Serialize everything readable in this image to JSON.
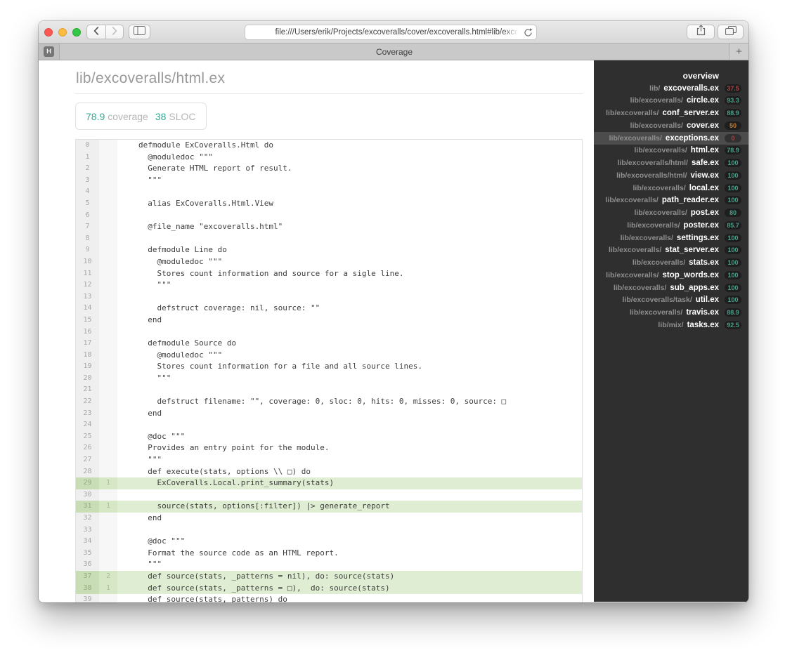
{
  "colors": {
    "accent": "#35a893",
    "pct_green": "#4d9c89",
    "pct_red": "#a84546",
    "pct_orange": "#bf7d35",
    "light_red": "#fc5753",
    "light_yellow": "#fdbc40",
    "light_green": "#33c748",
    "covered_num": "#c8ddb6",
    "covered_hits": "#d6e7c6",
    "covered_src": "#dfeed2",
    "selected_row": "#4c4c4c"
  },
  "window": {
    "url": "file:///Users/erik/Projects/excoveralls/cover/excoveralls.html#lib/exco",
    "tab_title": "Coverage",
    "pinned_tab": "H",
    "new_tab_glyph": "+"
  },
  "page": {
    "title": "lib/excoveralls/html.ex",
    "badge": {
      "coverage_value": "78.9",
      "coverage_label": "coverage",
      "sloc_value": "38",
      "sloc_label": "SLOC"
    }
  },
  "code": {
    "lines": [
      {
        "n": 0,
        "hits": "",
        "covered": false,
        "text": "defmodule ExCoveralls.Html do"
      },
      {
        "n": 1,
        "hits": "",
        "covered": false,
        "text": "  @moduledoc \"\"\""
      },
      {
        "n": 2,
        "hits": "",
        "covered": false,
        "text": "  Generate HTML report of result."
      },
      {
        "n": 3,
        "hits": "",
        "covered": false,
        "text": "  \"\"\""
      },
      {
        "n": 4,
        "hits": "",
        "covered": false,
        "text": ""
      },
      {
        "n": 5,
        "hits": "",
        "covered": false,
        "text": "  alias ExCoveralls.Html.View"
      },
      {
        "n": 6,
        "hits": "",
        "covered": false,
        "text": ""
      },
      {
        "n": 7,
        "hits": "",
        "covered": false,
        "text": "  @file_name \"excoveralls.html\""
      },
      {
        "n": 8,
        "hits": "",
        "covered": false,
        "text": ""
      },
      {
        "n": 9,
        "hits": "",
        "covered": false,
        "text": "  defmodule Line do"
      },
      {
        "n": 10,
        "hits": "",
        "covered": false,
        "text": "    @moduledoc \"\"\""
      },
      {
        "n": 11,
        "hits": "",
        "covered": false,
        "text": "    Stores count information and source for a sigle line."
      },
      {
        "n": 12,
        "hits": "",
        "covered": false,
        "text": "    \"\"\""
      },
      {
        "n": 13,
        "hits": "",
        "covered": false,
        "text": ""
      },
      {
        "n": 14,
        "hits": "",
        "covered": false,
        "text": "    defstruct coverage: nil, source: \"\""
      },
      {
        "n": 15,
        "hits": "",
        "covered": false,
        "text": "  end"
      },
      {
        "n": 16,
        "hits": "",
        "covered": false,
        "text": ""
      },
      {
        "n": 17,
        "hits": "",
        "covered": false,
        "text": "  defmodule Source do"
      },
      {
        "n": 18,
        "hits": "",
        "covered": false,
        "text": "    @moduledoc \"\"\""
      },
      {
        "n": 19,
        "hits": "",
        "covered": false,
        "text": "    Stores count information for a file and all source lines."
      },
      {
        "n": 20,
        "hits": "",
        "covered": false,
        "text": "    \"\"\""
      },
      {
        "n": 21,
        "hits": "",
        "covered": false,
        "text": ""
      },
      {
        "n": 22,
        "hits": "",
        "covered": false,
        "text": "    defstruct filename: \"\", coverage: 0, sloc: 0, hits: 0, misses: 0, source: □"
      },
      {
        "n": 23,
        "hits": "",
        "covered": false,
        "text": "  end"
      },
      {
        "n": 24,
        "hits": "",
        "covered": false,
        "text": ""
      },
      {
        "n": 25,
        "hits": "",
        "covered": false,
        "text": "  @doc \"\"\""
      },
      {
        "n": 26,
        "hits": "",
        "covered": false,
        "text": "  Provides an entry point for the module."
      },
      {
        "n": 27,
        "hits": "",
        "covered": false,
        "text": "  \"\"\""
      },
      {
        "n": 28,
        "hits": "",
        "covered": false,
        "text": "  def execute(stats, options \\\\ □) do"
      },
      {
        "n": 29,
        "hits": "1",
        "covered": true,
        "text": "    ExCoveralls.Local.print_summary(stats)"
      },
      {
        "n": 30,
        "hits": "",
        "covered": false,
        "text": ""
      },
      {
        "n": 31,
        "hits": "1",
        "covered": true,
        "text": "    source(stats, options[:filter]) |> generate_report"
      },
      {
        "n": 32,
        "hits": "",
        "covered": false,
        "text": "  end"
      },
      {
        "n": 33,
        "hits": "",
        "covered": false,
        "text": ""
      },
      {
        "n": 34,
        "hits": "",
        "covered": false,
        "text": "  @doc \"\"\""
      },
      {
        "n": 35,
        "hits": "",
        "covered": false,
        "text": "  Format the source code as an HTML report."
      },
      {
        "n": 36,
        "hits": "",
        "covered": false,
        "text": "  \"\"\""
      },
      {
        "n": 37,
        "hits": "2",
        "covered": true,
        "text": "  def source(stats, _patterns = nil), do: source(stats)"
      },
      {
        "n": 38,
        "hits": "1",
        "covered": true,
        "text": "  def source(stats, _patterns = □),  do: source(stats)"
      },
      {
        "n": 39,
        "hits": "",
        "covered": false,
        "text": "  def source(stats, patterns) do"
      }
    ]
  },
  "sidebar": {
    "items": [
      {
        "prefix": "",
        "name": "overview",
        "pct": "",
        "level": "",
        "selected": false
      },
      {
        "prefix": "lib/",
        "name": "excoveralls.ex",
        "pct": "37.5",
        "level": "low",
        "selected": false
      },
      {
        "prefix": "lib/excoveralls/",
        "name": "circle.ex",
        "pct": "93.3",
        "level": "high",
        "selected": false
      },
      {
        "prefix": "lib/excoveralls/",
        "name": "conf_server.ex",
        "pct": "88.9",
        "level": "high",
        "selected": false
      },
      {
        "prefix": "lib/excoveralls/",
        "name": "cover.ex",
        "pct": "50",
        "level": "mid",
        "selected": false
      },
      {
        "prefix": "lib/excoveralls/",
        "name": "exceptions.ex",
        "pct": "0",
        "level": "low",
        "selected": true
      },
      {
        "prefix": "lib/excoveralls/",
        "name": "html.ex",
        "pct": "78.9",
        "level": "high",
        "selected": false
      },
      {
        "prefix": "lib/excoveralls/html/",
        "name": "safe.ex",
        "pct": "100",
        "level": "high",
        "selected": false
      },
      {
        "prefix": "lib/excoveralls/html/",
        "name": "view.ex",
        "pct": "100",
        "level": "high",
        "selected": false
      },
      {
        "prefix": "lib/excoveralls/",
        "name": "local.ex",
        "pct": "100",
        "level": "high",
        "selected": false
      },
      {
        "prefix": "lib/excoveralls/",
        "name": "path_reader.ex",
        "pct": "100",
        "level": "high",
        "selected": false
      },
      {
        "prefix": "lib/excoveralls/",
        "name": "post.ex",
        "pct": "80",
        "level": "high",
        "selected": false
      },
      {
        "prefix": "lib/excoveralls/",
        "name": "poster.ex",
        "pct": "85.7",
        "level": "high",
        "selected": false
      },
      {
        "prefix": "lib/excoveralls/",
        "name": "settings.ex",
        "pct": "100",
        "level": "high",
        "selected": false
      },
      {
        "prefix": "lib/excoveralls/",
        "name": "stat_server.ex",
        "pct": "100",
        "level": "high",
        "selected": false
      },
      {
        "prefix": "lib/excoveralls/",
        "name": "stats.ex",
        "pct": "100",
        "level": "high",
        "selected": false
      },
      {
        "prefix": "lib/excoveralls/",
        "name": "stop_words.ex",
        "pct": "100",
        "level": "high",
        "selected": false
      },
      {
        "prefix": "lib/excoveralls/",
        "name": "sub_apps.ex",
        "pct": "100",
        "level": "high",
        "selected": false
      },
      {
        "prefix": "lib/excoveralls/task/",
        "name": "util.ex",
        "pct": "100",
        "level": "high",
        "selected": false
      },
      {
        "prefix": "lib/excoveralls/",
        "name": "travis.ex",
        "pct": "88.9",
        "level": "high",
        "selected": false
      },
      {
        "prefix": "lib/mix/",
        "name": "tasks.ex",
        "pct": "92.5",
        "level": "high",
        "selected": false
      }
    ]
  }
}
